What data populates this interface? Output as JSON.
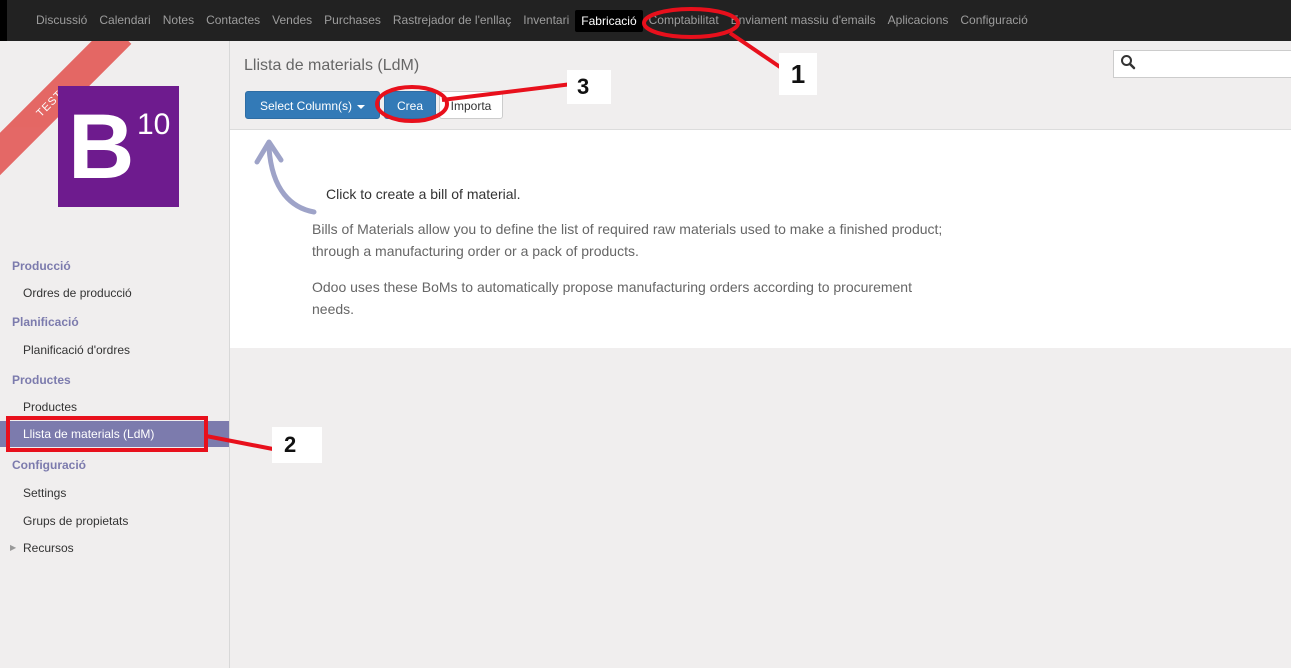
{
  "topmenu": {
    "items": [
      "Discussió",
      "Calendari",
      "Notes",
      "Contactes",
      "Vendes",
      "Purchases",
      "Rastrejador de l'enllaç",
      "Inventari",
      "Fabricació",
      "Comptabilitat",
      "Enviament massiu d'emails",
      "Aplicacions",
      "Configuració"
    ],
    "active": "Fabricació"
  },
  "sidebar": {
    "ribbon": "TEST",
    "logo_letter": "B",
    "logo_number": "10",
    "sections": [
      {
        "title": "Producció",
        "items": [
          "Ordres de producció"
        ]
      },
      {
        "title": "Planificació",
        "items": [
          "Planificació d'ordres"
        ]
      },
      {
        "title": "Productes",
        "items": [
          "Productes",
          "Llista de materials (LdM)"
        ]
      },
      {
        "title": "Configuració",
        "items": [
          "Settings",
          "Grups de propietats",
          "Recursos"
        ]
      }
    ],
    "active_item": "Llista de materials (LdM)"
  },
  "control_panel": {
    "breadcrumb": "Llista de materials (LdM)",
    "select_columns_label": "Select Column(s)",
    "create_label": "Crea",
    "import_label": "Importa",
    "search_placeholder": ""
  },
  "help": {
    "title": "Click to create a bill of material.",
    "paragraph1": "Bills of Materials allow you to define the list of required raw materials used to make a finished product; through a manufacturing order or a pack of products.",
    "paragraph2": "Odoo uses these BoMs to automatically propose manufacturing orders according to procurement needs."
  },
  "annotations": {
    "label1": "1",
    "label2": "2",
    "label3": "3",
    "color": "#e8101c"
  }
}
